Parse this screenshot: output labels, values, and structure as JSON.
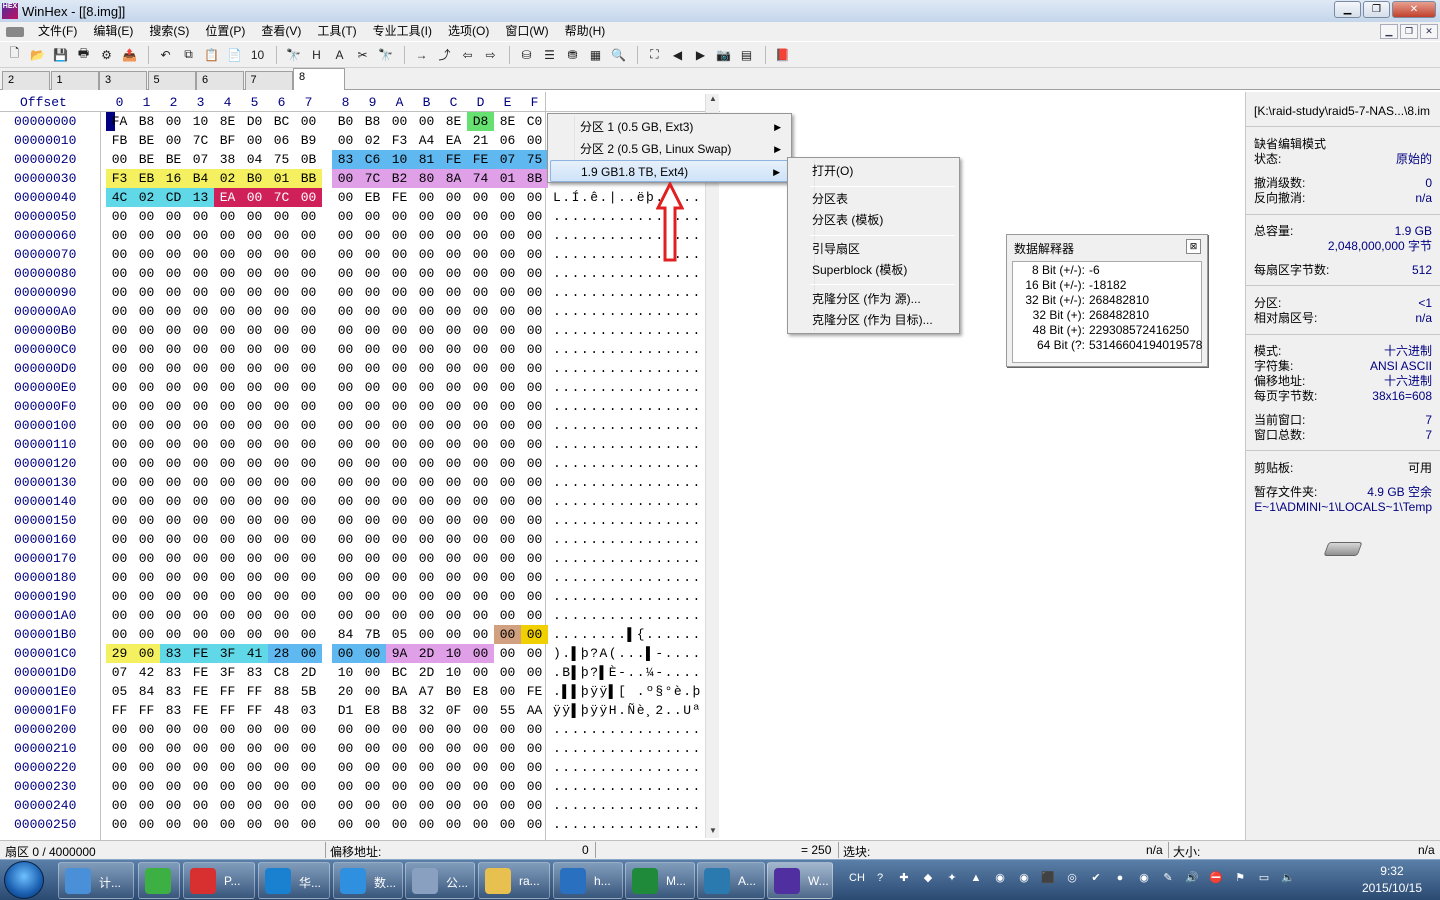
{
  "window": {
    "title": "WinHex - [[8.img]]",
    "app_icon": "HEX"
  },
  "menu": [
    "文件(F)",
    "编辑(E)",
    "搜索(S)",
    "位置(P)",
    "查看(V)",
    "工具(T)",
    "专业工具(I)",
    "选项(O)",
    "窗口(W)",
    "帮助(H)"
  ],
  "toolbar_icons": [
    "new-file-icon",
    "open-icon",
    "save-icon",
    "print-icon",
    "properties-icon",
    "open-disk-icon",
    "undo-icon",
    "copy-icon",
    "paste-icon",
    "clipboard-icon",
    "binary-icon",
    "find-icon",
    "find-hex-icon",
    "find-text-icon",
    "replace-icon",
    "find-next-icon",
    "goto-icon",
    "goto-offset-icon",
    "back-icon",
    "forward-icon",
    "disk-edit-icon",
    "ram-edit-icon",
    "disk-icon",
    "calculator-icon",
    "zoom-icon",
    "scan-icon",
    "prev-icon",
    "next-icon",
    "snapshot-icon",
    "table-icon",
    "book-icon"
  ],
  "toolbar_glyphs": [
    "🗋",
    "📂",
    "💾",
    "🖶",
    "⚙",
    "📤",
    "↶",
    "⧉",
    "📋",
    "📄",
    "10",
    "🔭",
    "H",
    "A",
    "✂",
    "🔭",
    "→",
    "⤴",
    "⇦",
    "⇨",
    "⛁",
    "☰",
    "⛃",
    "▦",
    "🔍",
    "⛶",
    "◀",
    "▶",
    "📷",
    "▤",
    "📕"
  ],
  "tabs": [
    "2",
    "1",
    "3",
    "5",
    "6",
    "7",
    "8"
  ],
  "active_tab": "8",
  "hex_header": {
    "offset": "Offset",
    "cols": [
      "0",
      "1",
      "2",
      "3",
      "4",
      "5",
      "6",
      "7",
      "8",
      "9",
      "A",
      "B",
      "C",
      "D",
      "E",
      "F"
    ]
  },
  "rows": [
    {
      "off": "00000000",
      "bytes": [
        "FA",
        "B8",
        "00",
        "10",
        "8E",
        "D0",
        "BC",
        "00",
        "B0",
        "B8",
        "00",
        "00",
        "8E",
        "D8",
        "8E",
        "C0"
      ],
      "ascii": "........"
    },
    {
      "off": "00000010",
      "bytes": [
        "FB",
        "BE",
        "00",
        "7C",
        "BF",
        "00",
        "06",
        "B9",
        "00",
        "02",
        "F3",
        "A4",
        "EA",
        "21",
        "06",
        "00"
      ],
      "ascii": ""
    },
    {
      "off": "00000020",
      "bytes": [
        "00",
        "BE",
        "BE",
        "07",
        "38",
        "04",
        "75",
        "0B",
        "83",
        "C6",
        "10",
        "81",
        "FE",
        "FE",
        "07",
        "75"
      ],
      "ascii": ""
    },
    {
      "off": "00000030",
      "bytes": [
        "F3",
        "EB",
        "16",
        "B4",
        "02",
        "B0",
        "01",
        "BB",
        "00",
        "7C",
        "B2",
        "80",
        "8A",
        "74",
        "01",
        "8B"
      ],
      "ascii": ""
    },
    {
      "off": "00000040",
      "bytes": [
        "4C",
        "02",
        "CD",
        "13",
        "EA",
        "00",
        "7C",
        "00",
        "00",
        "EB",
        "FE",
        "00",
        "00",
        "00",
        "00",
        "00"
      ],
      "ascii": "L.Í.ê.|..ëþ....."
    },
    {
      "off": "00000050",
      "bytes": [
        "00",
        "00",
        "00",
        "00",
        "00",
        "00",
        "00",
        "00",
        "00",
        "00",
        "00",
        "00",
        "00",
        "00",
        "00",
        "00"
      ],
      "ascii": "................"
    },
    {
      "off": "00000060",
      "bytes": [
        "00",
        "00",
        "00",
        "00",
        "00",
        "00",
        "00",
        "00",
        "00",
        "00",
        "00",
        "00",
        "00",
        "00",
        "00",
        "00"
      ],
      "ascii": "................"
    },
    {
      "off": "00000070",
      "bytes": [
        "00",
        "00",
        "00",
        "00",
        "00",
        "00",
        "00",
        "00",
        "00",
        "00",
        "00",
        "00",
        "00",
        "00",
        "00",
        "00"
      ],
      "ascii": "................"
    },
    {
      "off": "00000080",
      "bytes": [
        "00",
        "00",
        "00",
        "00",
        "00",
        "00",
        "00",
        "00",
        "00",
        "00",
        "00",
        "00",
        "00",
        "00",
        "00",
        "00"
      ],
      "ascii": "................"
    },
    {
      "off": "00000090",
      "bytes": [
        "00",
        "00",
        "00",
        "00",
        "00",
        "00",
        "00",
        "00",
        "00",
        "00",
        "00",
        "00",
        "00",
        "00",
        "00",
        "00"
      ],
      "ascii": "................"
    },
    {
      "off": "000000A0",
      "bytes": [
        "00",
        "00",
        "00",
        "00",
        "00",
        "00",
        "00",
        "00",
        "00",
        "00",
        "00",
        "00",
        "00",
        "00",
        "00",
        "00"
      ],
      "ascii": "................"
    },
    {
      "off": "000000B0",
      "bytes": [
        "00",
        "00",
        "00",
        "00",
        "00",
        "00",
        "00",
        "00",
        "00",
        "00",
        "00",
        "00",
        "00",
        "00",
        "00",
        "00"
      ],
      "ascii": "................"
    },
    {
      "off": "000000C0",
      "bytes": [
        "00",
        "00",
        "00",
        "00",
        "00",
        "00",
        "00",
        "00",
        "00",
        "00",
        "00",
        "00",
        "00",
        "00",
        "00",
        "00"
      ],
      "ascii": "................"
    },
    {
      "off": "000000D0",
      "bytes": [
        "00",
        "00",
        "00",
        "00",
        "00",
        "00",
        "00",
        "00",
        "00",
        "00",
        "00",
        "00",
        "00",
        "00",
        "00",
        "00"
      ],
      "ascii": "................"
    },
    {
      "off": "000000E0",
      "bytes": [
        "00",
        "00",
        "00",
        "00",
        "00",
        "00",
        "00",
        "00",
        "00",
        "00",
        "00",
        "00",
        "00",
        "00",
        "00",
        "00"
      ],
      "ascii": "................"
    },
    {
      "off": "000000F0",
      "bytes": [
        "00",
        "00",
        "00",
        "00",
        "00",
        "00",
        "00",
        "00",
        "00",
        "00",
        "00",
        "00",
        "00",
        "00",
        "00",
        "00"
      ],
      "ascii": "................"
    },
    {
      "off": "00000100",
      "bytes": [
        "00",
        "00",
        "00",
        "00",
        "00",
        "00",
        "00",
        "00",
        "00",
        "00",
        "00",
        "00",
        "00",
        "00",
        "00",
        "00"
      ],
      "ascii": "................"
    },
    {
      "off": "00000110",
      "bytes": [
        "00",
        "00",
        "00",
        "00",
        "00",
        "00",
        "00",
        "00",
        "00",
        "00",
        "00",
        "00",
        "00",
        "00",
        "00",
        "00"
      ],
      "ascii": "................"
    },
    {
      "off": "00000120",
      "bytes": [
        "00",
        "00",
        "00",
        "00",
        "00",
        "00",
        "00",
        "00",
        "00",
        "00",
        "00",
        "00",
        "00",
        "00",
        "00",
        "00"
      ],
      "ascii": "................"
    },
    {
      "off": "00000130",
      "bytes": [
        "00",
        "00",
        "00",
        "00",
        "00",
        "00",
        "00",
        "00",
        "00",
        "00",
        "00",
        "00",
        "00",
        "00",
        "00",
        "00"
      ],
      "ascii": "................"
    },
    {
      "off": "00000140",
      "bytes": [
        "00",
        "00",
        "00",
        "00",
        "00",
        "00",
        "00",
        "00",
        "00",
        "00",
        "00",
        "00",
        "00",
        "00",
        "00",
        "00"
      ],
      "ascii": "................"
    },
    {
      "off": "00000150",
      "bytes": [
        "00",
        "00",
        "00",
        "00",
        "00",
        "00",
        "00",
        "00",
        "00",
        "00",
        "00",
        "00",
        "00",
        "00",
        "00",
        "00"
      ],
      "ascii": "................"
    },
    {
      "off": "00000160",
      "bytes": [
        "00",
        "00",
        "00",
        "00",
        "00",
        "00",
        "00",
        "00",
        "00",
        "00",
        "00",
        "00",
        "00",
        "00",
        "00",
        "00"
      ],
      "ascii": "................"
    },
    {
      "off": "00000170",
      "bytes": [
        "00",
        "00",
        "00",
        "00",
        "00",
        "00",
        "00",
        "00",
        "00",
        "00",
        "00",
        "00",
        "00",
        "00",
        "00",
        "00"
      ],
      "ascii": "................"
    },
    {
      "off": "00000180",
      "bytes": [
        "00",
        "00",
        "00",
        "00",
        "00",
        "00",
        "00",
        "00",
        "00",
        "00",
        "00",
        "00",
        "00",
        "00",
        "00",
        "00"
      ],
      "ascii": "................"
    },
    {
      "off": "00000190",
      "bytes": [
        "00",
        "00",
        "00",
        "00",
        "00",
        "00",
        "00",
        "00",
        "00",
        "00",
        "00",
        "00",
        "00",
        "00",
        "00",
        "00"
      ],
      "ascii": "................"
    },
    {
      "off": "000001A0",
      "bytes": [
        "00",
        "00",
        "00",
        "00",
        "00",
        "00",
        "00",
        "00",
        "00",
        "00",
        "00",
        "00",
        "00",
        "00",
        "00",
        "00"
      ],
      "ascii": "................"
    },
    {
      "off": "000001B0",
      "bytes": [
        "00",
        "00",
        "00",
        "00",
        "00",
        "00",
        "00",
        "00",
        "84",
        "7B",
        "05",
        "00",
        "00",
        "00",
        "00",
        "00"
      ],
      "ascii": "........▌{......"
    },
    {
      "off": "000001C0",
      "bytes": [
        "29",
        "00",
        "83",
        "FE",
        "3F",
        "41",
        "28",
        "00",
        "00",
        "00",
        "9A",
        "2D",
        "10",
        "00",
        "00",
        "00"
      ],
      "ascii": ").▌þ?A(...▌-...."
    },
    {
      "off": "000001D0",
      "bytes": [
        "07",
        "42",
        "83",
        "FE",
        "3F",
        "83",
        "C8",
        "2D",
        "10",
        "00",
        "BC",
        "2D",
        "10",
        "00",
        "00",
        "00"
      ],
      "ascii": ".B▌þ?▌È-..¼-...."
    },
    {
      "off": "000001E0",
      "bytes": [
        "05",
        "84",
        "83",
        "FE",
        "FF",
        "FF",
        "88",
        "5B",
        "20",
        "00",
        "BA",
        "A7",
        "B0",
        "E8",
        "00",
        "FE"
      ],
      "ascii": ".▌▌þÿÿ▌[ .º§°è.þ"
    },
    {
      "off": "000001F0",
      "bytes": [
        "FF",
        "FF",
        "83",
        "FE",
        "FF",
        "FF",
        "48",
        "03",
        "D1",
        "E8",
        "B8",
        "32",
        "0F",
        "00",
        "55",
        "AA"
      ],
      "ascii": "ÿÿ▌þÿÿH.Ñè¸2..Uª"
    },
    {
      "off": "00000200",
      "bytes": [
        "00",
        "00",
        "00",
        "00",
        "00",
        "00",
        "00",
        "00",
        "00",
        "00",
        "00",
        "00",
        "00",
        "00",
        "00",
        "00"
      ],
      "ascii": "................"
    },
    {
      "off": "00000210",
      "bytes": [
        "00",
        "00",
        "00",
        "00",
        "00",
        "00",
        "00",
        "00",
        "00",
        "00",
        "00",
        "00",
        "00",
        "00",
        "00",
        "00"
      ],
      "ascii": "................"
    },
    {
      "off": "00000220",
      "bytes": [
        "00",
        "00",
        "00",
        "00",
        "00",
        "00",
        "00",
        "00",
        "00",
        "00",
        "00",
        "00",
        "00",
        "00",
        "00",
        "00"
      ],
      "ascii": "................"
    },
    {
      "off": "00000230",
      "bytes": [
        "00",
        "00",
        "00",
        "00",
        "00",
        "00",
        "00",
        "00",
        "00",
        "00",
        "00",
        "00",
        "00",
        "00",
        "00",
        "00"
      ],
      "ascii": "................"
    },
    {
      "off": "00000240",
      "bytes": [
        "00",
        "00",
        "00",
        "00",
        "00",
        "00",
        "00",
        "00",
        "00",
        "00",
        "00",
        "00",
        "00",
        "00",
        "00",
        "00"
      ],
      "ascii": "................"
    },
    {
      "off": "00000250",
      "bytes": [
        "00",
        "00",
        "00",
        "00",
        "00",
        "00",
        "00",
        "00",
        "00",
        "00",
        "00",
        "00",
        "00",
        "00",
        "00",
        "00"
      ],
      "ascii": "................"
    }
  ],
  "highlights": [
    {
      "row": 0,
      "from": 13,
      "to": 13,
      "color": "#66e070"
    },
    {
      "row": 2,
      "from": 8,
      "to": 15,
      "color": "#60b8f0"
    },
    {
      "row": 3,
      "from": 0,
      "to": 7,
      "color": "#f4f060"
    },
    {
      "row": 3,
      "from": 8,
      "to": 15,
      "color": "#e0a0e8"
    },
    {
      "row": 4,
      "from": 0,
      "to": 3,
      "color": "#60d8e8"
    },
    {
      "row": 4,
      "from": 4,
      "to": 7,
      "color": "#d0205a"
    },
    {
      "row": 27,
      "from": 14,
      "to": 15,
      "color": "#f0d000"
    },
    {
      "row": 27,
      "from": 14,
      "to": 14,
      "color": "#d0a080"
    },
    {
      "row": 28,
      "from": 0,
      "to": 1,
      "color": "#f4f060"
    },
    {
      "row": 28,
      "from": 2,
      "to": 5,
      "color": "#60d8e8"
    },
    {
      "row": 28,
      "from": 6,
      "to": 9,
      "color": "#60b8f0"
    },
    {
      "row": 28,
      "from": 10,
      "to": 13,
      "color": "#e0a0e8"
    }
  ],
  "partition_menu": [
    {
      "label": "分区 1 (0.5 GB, Ext3)",
      "arrow": "▶"
    },
    {
      "label": "分区 2 (0.5 GB, Linux Swap)",
      "arrow": "▶"
    },
    {
      "label": "1.9 GB1.8 TB, Ext4)",
      "arrow": "▶"
    }
  ],
  "sub_menu": {
    "open": "打开(O)",
    "ptable": "分区表",
    "ptable_tpl": "分区表 (模板)",
    "boot": "引导扇区",
    "superblock": "Superblock (模板)",
    "clone_src": "克隆分区 (作为 源)...",
    "clone_dst": "克隆分区 (作为 目标)..."
  },
  "interpreter": {
    "title": "数据解释器",
    "close": "⊠",
    "rows": [
      {
        "l": "8 Bit (+/-):",
        "v": "-6"
      },
      {
        "l": "16 Bit (+/-):",
        "v": "-18182"
      },
      {
        "l": "32 Bit (+/-):",
        "v": "268482810"
      },
      {
        "l": "32 Bit (+):",
        "v": "268482810"
      },
      {
        "l": "48 Bit (+):",
        "v": "229308572416250"
      },
      {
        "l": "64 Bit (?:",
        "v": "53146604194019578"
      }
    ]
  },
  "info": {
    "path": "[K:\\raid-study\\raid5-7-NAS...\\8.im",
    "edit_mode": "缺省编辑模式",
    "state_l": "状态:",
    "state_v": "原始的",
    "undo_l": "撤消级数:",
    "undo_v": "0",
    "redo_l": "反向撤消:",
    "redo_v": "n/a",
    "cap_l": "总容量:",
    "cap_v": "1.9 GB",
    "cap_bytes": "2,048,000,000 字节",
    "bps_l": "每扇区字节数:",
    "bps_v": "512",
    "part_l": "分区:",
    "part_v": "<1",
    "relsec_l": "相对扇区号:",
    "relsec_v": "n/a",
    "mode_l": "模式:",
    "mode_v": "十六进制",
    "charset_l": "字符集:",
    "charset_v": "ANSI ASCII",
    "offaddr_l": "偏移地址:",
    "offaddr_v": "十六进制",
    "bpp_l": "每页字节数:",
    "bpp_v": "38x16=608",
    "curwin_l": "当前窗口:",
    "curwin_v": "7",
    "totwin_l": "窗口总数:",
    "totwin_v": "7",
    "clip_l": "剪贴板:",
    "clip_v": "可用",
    "temp_l": "暂存文件夹:",
    "temp_v": "4.9 GB 空余",
    "temp_path": "E~1\\ADMINI~1\\LOCALS~1\\Temp"
  },
  "status": {
    "sector": "扇区 0 / 4000000",
    "offset_l": "偏移地址:",
    "offset_v": "0",
    "value": "= 250",
    "block_l": "选块:",
    "block_v": "n/a",
    "size_l": "大小:",
    "size_v": "n/a"
  },
  "taskbar": [
    {
      "label": "计...",
      "color": "#4a90d9"
    },
    {
      "label": "",
      "color": "#3cb043"
    },
    {
      "label": "P...",
      "color": "#d83030"
    },
    {
      "label": "华...",
      "color": "#1a80d0"
    },
    {
      "label": "数...",
      "color": "#3090e0"
    },
    {
      "label": "公...",
      "color": "#8aa0c0"
    },
    {
      "label": "ra...",
      "color": "#e8c050"
    },
    {
      "label": "h...",
      "color": "#2a70c0"
    },
    {
      "label": "M...",
      "color": "#1e8a3a"
    },
    {
      "label": "A...",
      "color": "#2a7ab0"
    },
    {
      "label": "W...",
      "color": "#5030a0"
    }
  ],
  "tray": {
    "lang": "CH",
    "icons": [
      "?",
      "✚",
      "◆",
      "✦",
      "▲",
      "◉",
      "◉",
      "⬛",
      "◎",
      "✔",
      "●",
      "◉",
      "✎",
      "🔊",
      "⛔",
      "⚑",
      "▭",
      "🔈"
    ]
  },
  "clock": {
    "time": "9:32",
    "date": "2015/10/15"
  },
  "colors": {
    "offset": "#000080",
    "accent": "#000080",
    "arrow": "#e02020"
  }
}
